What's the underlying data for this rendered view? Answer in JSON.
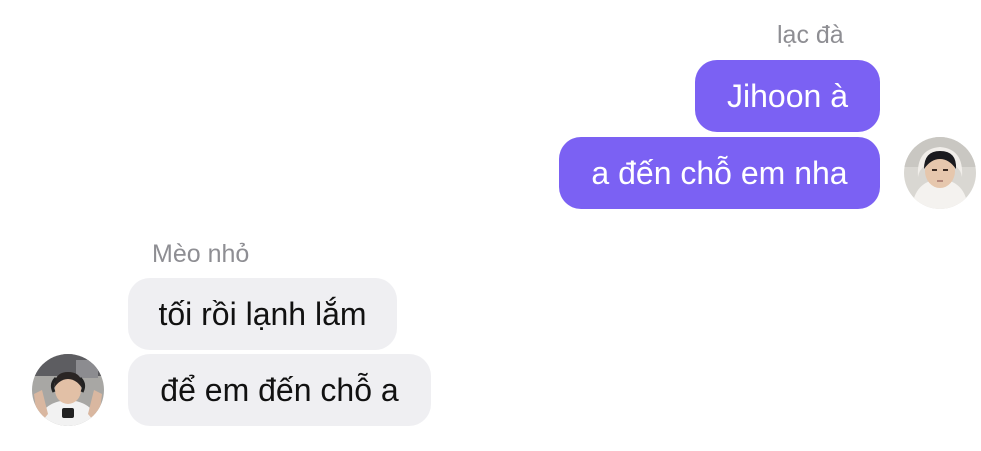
{
  "thread": {
    "outgoing": {
      "sender_name": "lạc đà",
      "messages": [
        "Jihoon à",
        "a đến chỗ em nha"
      ],
      "avatar_icon": "user-avatar-photo",
      "bubble_color": "#7b61f3"
    },
    "incoming": {
      "sender_name": "Mèo nhỏ",
      "messages": [
        "tối rồi lạnh lắm",
        "để em đến chỗ a"
      ],
      "avatar_icon": "user-avatar-photo",
      "bubble_color": "#efeff2"
    }
  }
}
